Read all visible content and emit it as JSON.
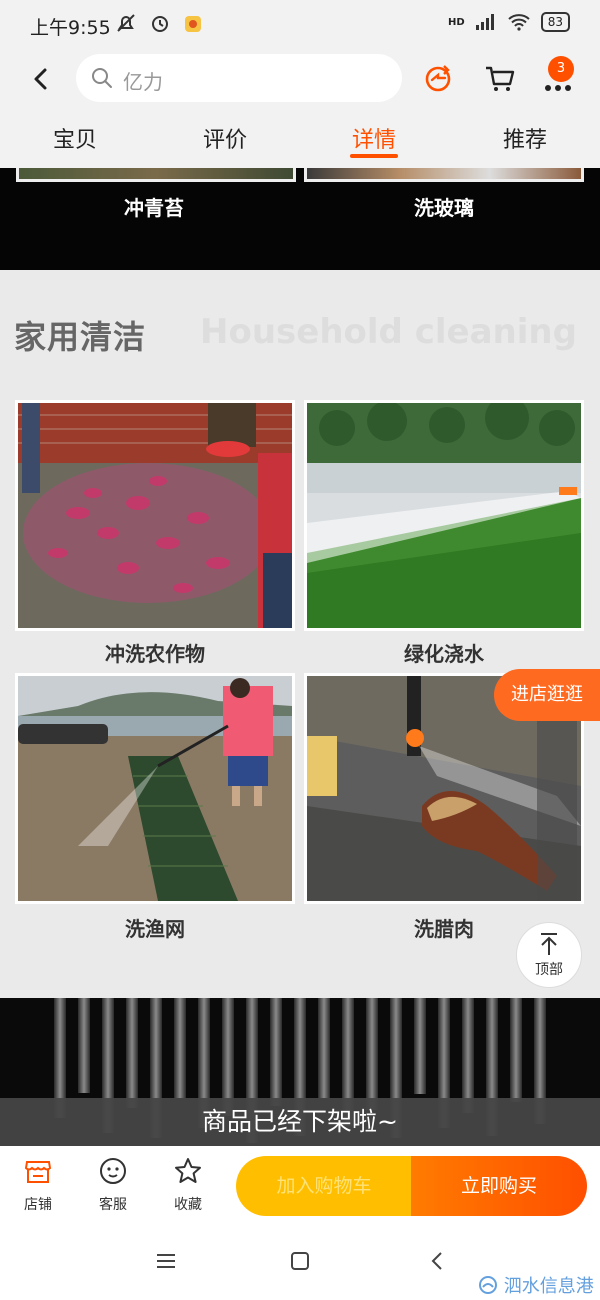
{
  "status_bar": {
    "time": "上午9:55",
    "network": "HD",
    "battery": "83"
  },
  "header": {
    "search_placeholder": "亿力",
    "cart_badge": "3",
    "tabs": [
      {
        "label": "宝贝"
      },
      {
        "label": "评价"
      },
      {
        "label": "详情",
        "active": true
      },
      {
        "label": "推荐"
      }
    ]
  },
  "content": {
    "top_captions": [
      "冲青苔",
      "洗玻璃"
    ],
    "section": {
      "title": "家用清洁",
      "title_en": "Household cleaning"
    },
    "items": [
      {
        "caption": "冲洗农作物",
        "image": "potato-pile"
      },
      {
        "caption": "绿化浇水",
        "image": "lawn-spray"
      },
      {
        "caption": "洗渔网",
        "image": "fishnet-wash"
      },
      {
        "caption": "洗腊肉",
        "image": "bacon-wash"
      }
    ],
    "float_shop_button": "进店逛逛",
    "back_to_top_label": "顶部",
    "sold_out_notice": "商品已经下架啦~"
  },
  "bottom_bar": {
    "shop_label": "店铺",
    "service_label": "客服",
    "favorite_label": "收藏",
    "add_to_cart_label": "加入购物车",
    "buy_now_label": "立即购买"
  },
  "watermark": "泗水信息港",
  "colors": {
    "accent": "#ff5000",
    "cart_button": "#ffbf00",
    "buy_button": "#ff5a00"
  }
}
